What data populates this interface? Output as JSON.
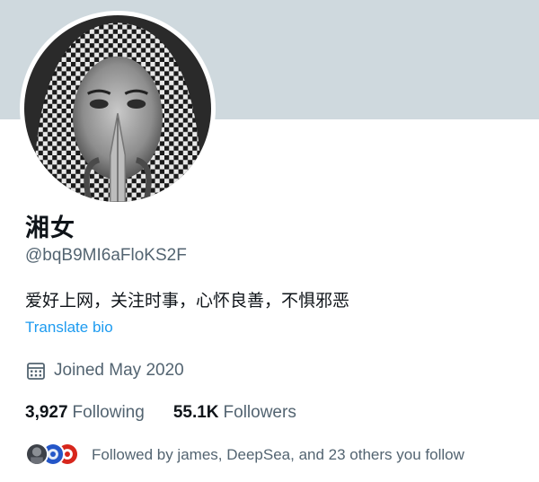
{
  "profile": {
    "display_name": "湘女",
    "handle": "@bqB9MI6aFloKS2F",
    "bio": "爱好上网，关注时事，心怀良善，不惧邪恶",
    "translate_label": "Translate bio",
    "joined": "Joined May 2020"
  },
  "stats": {
    "following_count": "3,927",
    "following_label": "Following",
    "followers_count": "55.1K",
    "followers_label": "Followers"
  },
  "followed_by": {
    "text": "Followed by james, DeepSea, and 23 others you follow"
  },
  "colors": {
    "banner": "#cfd9de",
    "link": "#1d9bf0",
    "secondary_text": "#536471"
  },
  "icons": {
    "joined": "calendar-icon"
  }
}
